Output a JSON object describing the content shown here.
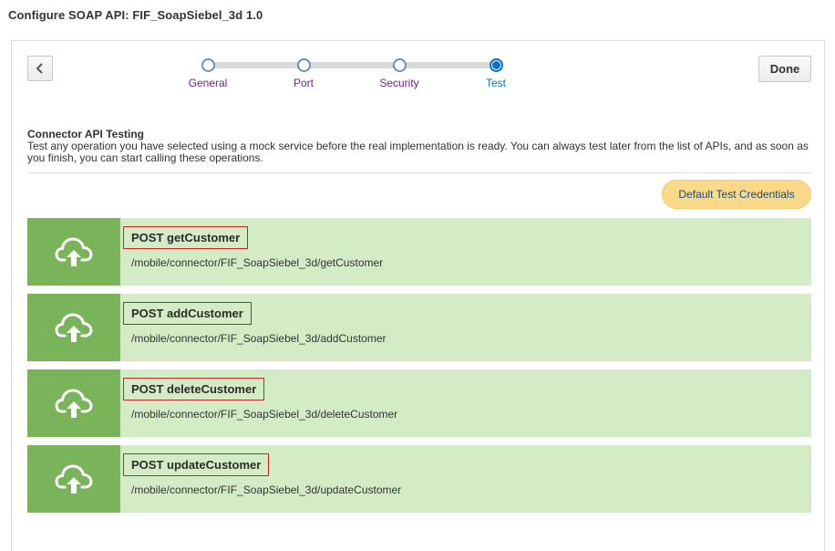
{
  "page": {
    "title": "Configure SOAP API: FIF_SoapSiebel_3d 1.0"
  },
  "toolbar": {
    "done_label": "Done"
  },
  "train": {
    "steps": [
      {
        "label": "General"
      },
      {
        "label": "Port"
      },
      {
        "label": "Security"
      },
      {
        "label": "Test"
      }
    ],
    "current_step": "Test"
  },
  "testing": {
    "heading": "Connector API Testing",
    "description": "Test any operation you have selected using a mock service before the real implementation is ready. You can always test later from the list of APIs, and as soon as you finish, you can start calling these operations.",
    "credentials_label": "Default Test Credentials"
  },
  "apis": [
    {
      "title": "POST getCustomer",
      "path": "/mobile/connector/FIF_SoapSiebel_3d/getCustomer"
    },
    {
      "title": "POST addCustomer",
      "path": "/mobile/connector/FIF_SoapSiebel_3d/addCustomer"
    },
    {
      "title": "POST deleteCustomer",
      "path": "/mobile/connector/FIF_SoapSiebel_3d/deleteCustomer"
    },
    {
      "title": "POST updateCustomer",
      "path": "/mobile/connector/FIF_SoapSiebel_3d/updateCustomer"
    }
  ],
  "icons": {
    "back": "chevron-left-icon",
    "api": "cloud-upload-icon"
  },
  "colors": {
    "api_row_bg": "#d3ecc5",
    "api_icon_bg": "#79b35a",
    "credentials_bg": "#fbd989",
    "train_active": "#0572ce",
    "train_visited_label": "#6a2389"
  }
}
